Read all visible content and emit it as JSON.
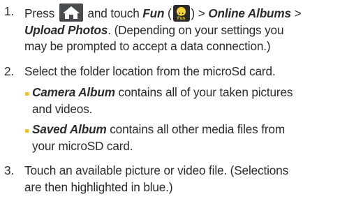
{
  "steps": [
    {
      "number": "1.",
      "line1": {
        "t1": "Press",
        "t2": "and touch",
        "fun": "Fun",
        "paren_open": "(",
        "paren_close": ")",
        "sep1": " > ",
        "online": "Online Albums",
        "sep2": " > "
      },
      "line2": {
        "upload": "Upload Photos",
        "rest": ". (Depending on your settings you"
      },
      "line3": "may be prompted to accept a data connection.)"
    },
    {
      "number": "2.",
      "text": "Select the folder location from the microSd card.",
      "bullets": [
        {
          "em": "Camera Album",
          "rest": " contains all of your taken pictures",
          "line2": "and videos."
        },
        {
          "em": "Saved Album",
          "rest": " contains all other media files from",
          "line2": "your microSD card."
        }
      ]
    },
    {
      "number": "3.",
      "line1": "Touch an available picture or video file. (Selections",
      "line2": "are then highlighted in blue.)"
    }
  ],
  "icons": {
    "home": "home-icon",
    "fun": "fun-icon",
    "fun_label": "Fun"
  },
  "colors": {
    "bullet": "#f1c232",
    "text": "#2b2b2b",
    "icon_bg": "#4a4d4f",
    "fun_face": "#f4d23a"
  }
}
